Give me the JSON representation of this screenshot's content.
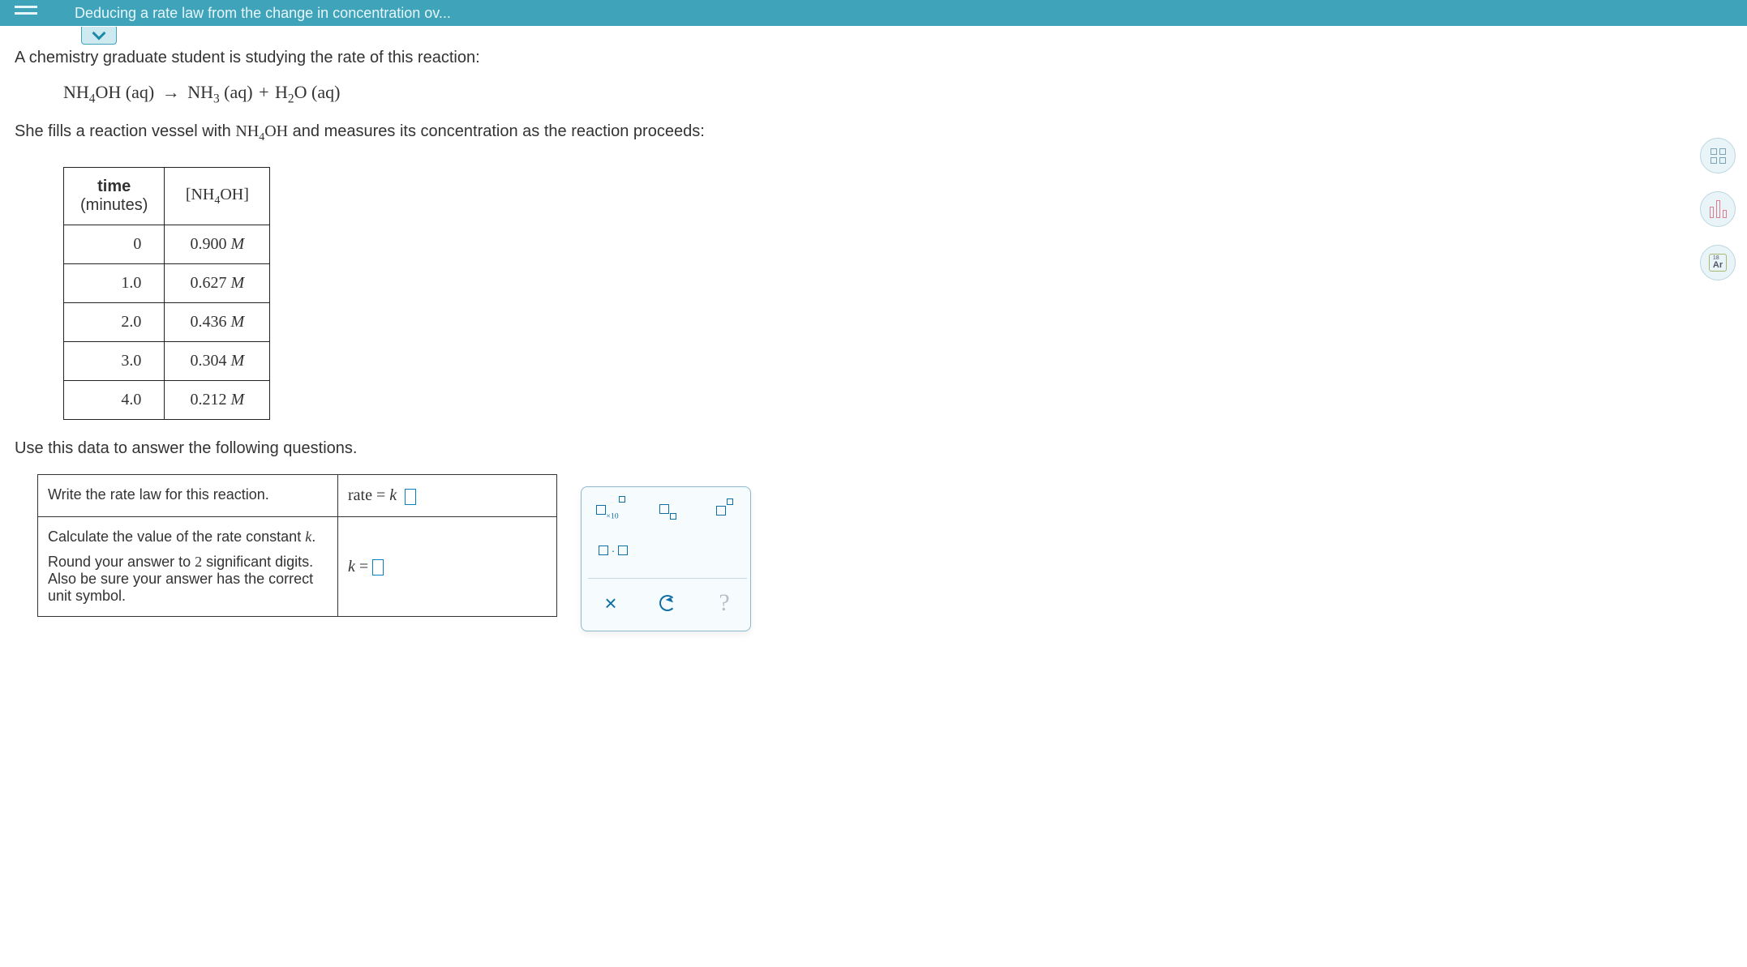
{
  "header": {
    "title": "Deducing a rate law from the change in concentration ov..."
  },
  "body": {
    "intro1": "A chemistry graduate student is studying the rate of this reaction:",
    "intro2a": "She fills a reaction vessel with ",
    "intro2b": " and measures its concentration as the reaction proceeds:",
    "instr": "Use this data to answer the following questions."
  },
  "equation": {
    "lhs_species": "NH",
    "lhs_sub": "4",
    "lhs_anion": "OH",
    "lhs_state": "(aq)",
    "arrow": "→",
    "p1_species": "NH",
    "p1_sub": "3",
    "p1_state": "(aq)",
    "plus": "+",
    "p2_species": "H",
    "p2_sub": "2",
    "p2_anion": "O",
    "p2_state": "(aq)"
  },
  "table": {
    "col1_a": "time",
    "col1_b": "(minutes)",
    "col2_pre": "[NH",
    "col2_sub": "4",
    "col2_post": "OH]",
    "rows": [
      {
        "t": "0",
        "c": "0.900",
        "u": "M"
      },
      {
        "t": "1.0",
        "c": "0.627",
        "u": "M"
      },
      {
        "t": "2.0",
        "c": "0.436",
        "u": "M"
      },
      {
        "t": "3.0",
        "c": "0.304",
        "u": "M"
      },
      {
        "t": "4.0",
        "c": "0.212",
        "u": "M"
      }
    ]
  },
  "questions": {
    "q1": "Write the rate law for this reaction.",
    "r1a": "rate ",
    "r1b": "= ",
    "r1c": "k",
    "q2a": "Calculate the value of the rate constant ",
    "q2b": "k",
    "q2c": ".",
    "q2d": "Round your answer to ",
    "q2e": "2",
    "q2f": " significant digits. Also be sure your answer has the correct unit symbol.",
    "r2a": "k",
    "r2b": " = "
  },
  "toolbox": {
    "sci_label": "×10",
    "dot_label": "·",
    "clear_label": "×",
    "help_label": "?"
  },
  "side": {
    "periodic_label": "Ar",
    "periodic_num": "18"
  }
}
